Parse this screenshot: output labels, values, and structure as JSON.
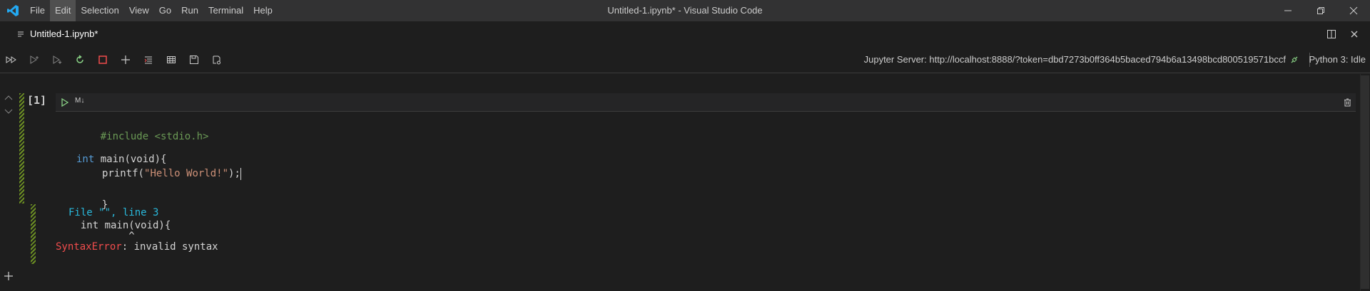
{
  "titlebar": {
    "menus": [
      "File",
      "Edit",
      "Selection",
      "View",
      "Go",
      "Run",
      "Terminal",
      "Help"
    ],
    "active_menu": "Edit",
    "window_title": "Untitled-1.ipynb* - Visual Studio Code"
  },
  "tab": {
    "label": "Untitled-1.ipynb*"
  },
  "toolbar": {
    "server_label": "Jupyter Server: http://localhost:8888/?token=dbd7273b0ff364b5baced794b6a13498bcd800519571bccf",
    "kernel_label": "Python 3: Idle"
  },
  "cell": {
    "exec_count": "[1]",
    "md_toggle": "M↓",
    "code": {
      "line1": "#include <stdio.h>",
      "line3_kw": "int",
      "line3_rest": " main(void){",
      "line4_call": "printf(",
      "line4_str": "\"Hello World!\"",
      "line4_end": ");",
      "line5": "}"
    },
    "output": {
      "line1": "File \"\", line 3",
      "line2": "  int main(void){",
      "line3": "          ^",
      "error_name": "SyntaxError",
      "error_msg": ": invalid syntax"
    }
  },
  "colors": {
    "accent": "#007acc",
    "cell_stripe": "#6b8e23",
    "error": "#f14c4c",
    "keyword": "#569cd6",
    "string": "#ce9178"
  }
}
